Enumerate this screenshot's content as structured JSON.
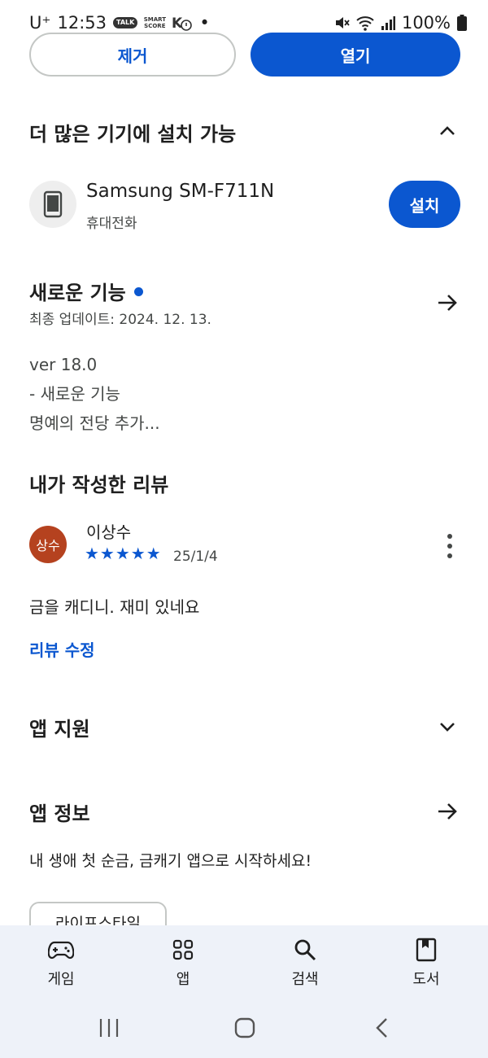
{
  "status_bar": {
    "carrier": "U⁺",
    "time": "12:53",
    "talk_badge": "TALK",
    "smart_score_badge": "SMART SCORE",
    "dot": "•",
    "battery": "100%"
  },
  "actions": {
    "remove_label": "제거",
    "open_label": "열기"
  },
  "more_devices": {
    "title": "더 많은 기기에 설치 가능",
    "device_name": "Samsung SM-F711N",
    "device_type": "휴대전화",
    "install_label": "설치"
  },
  "whats_new": {
    "title": "새로운 기능",
    "updated": "최종 업데이트: 2024. 12. 13.",
    "lines": [
      "ver 18.0",
      "- 새로운 기능",
      "명예의 전당 추가..."
    ]
  },
  "my_review": {
    "title": "내가 작성한 리뷰",
    "avatar_text": "상수",
    "reviewer": "이상수",
    "stars": "★★★★★",
    "rating": 5,
    "date": "25/1/4",
    "text": "금을 캐디니. 재미 있네요",
    "edit_label": "리뷰 수정"
  },
  "app_support": {
    "title": "앱 지원"
  },
  "app_info": {
    "title": "앱 정보",
    "description": "내 생애 첫 순금, 금캐기 앱으로 시작하세요!",
    "chip": "라이프스타일"
  },
  "bottom_nav": [
    {
      "label": "게임",
      "icon": "gamepad-icon"
    },
    {
      "label": "앱",
      "icon": "apps-grid-icon"
    },
    {
      "label": "검색",
      "icon": "search-icon"
    },
    {
      "label": "도서",
      "icon": "book-icon"
    }
  ],
  "colors": {
    "accent": "#0b57d0",
    "avatar": "#b5421f",
    "nav_bg": "#eef2f9"
  }
}
